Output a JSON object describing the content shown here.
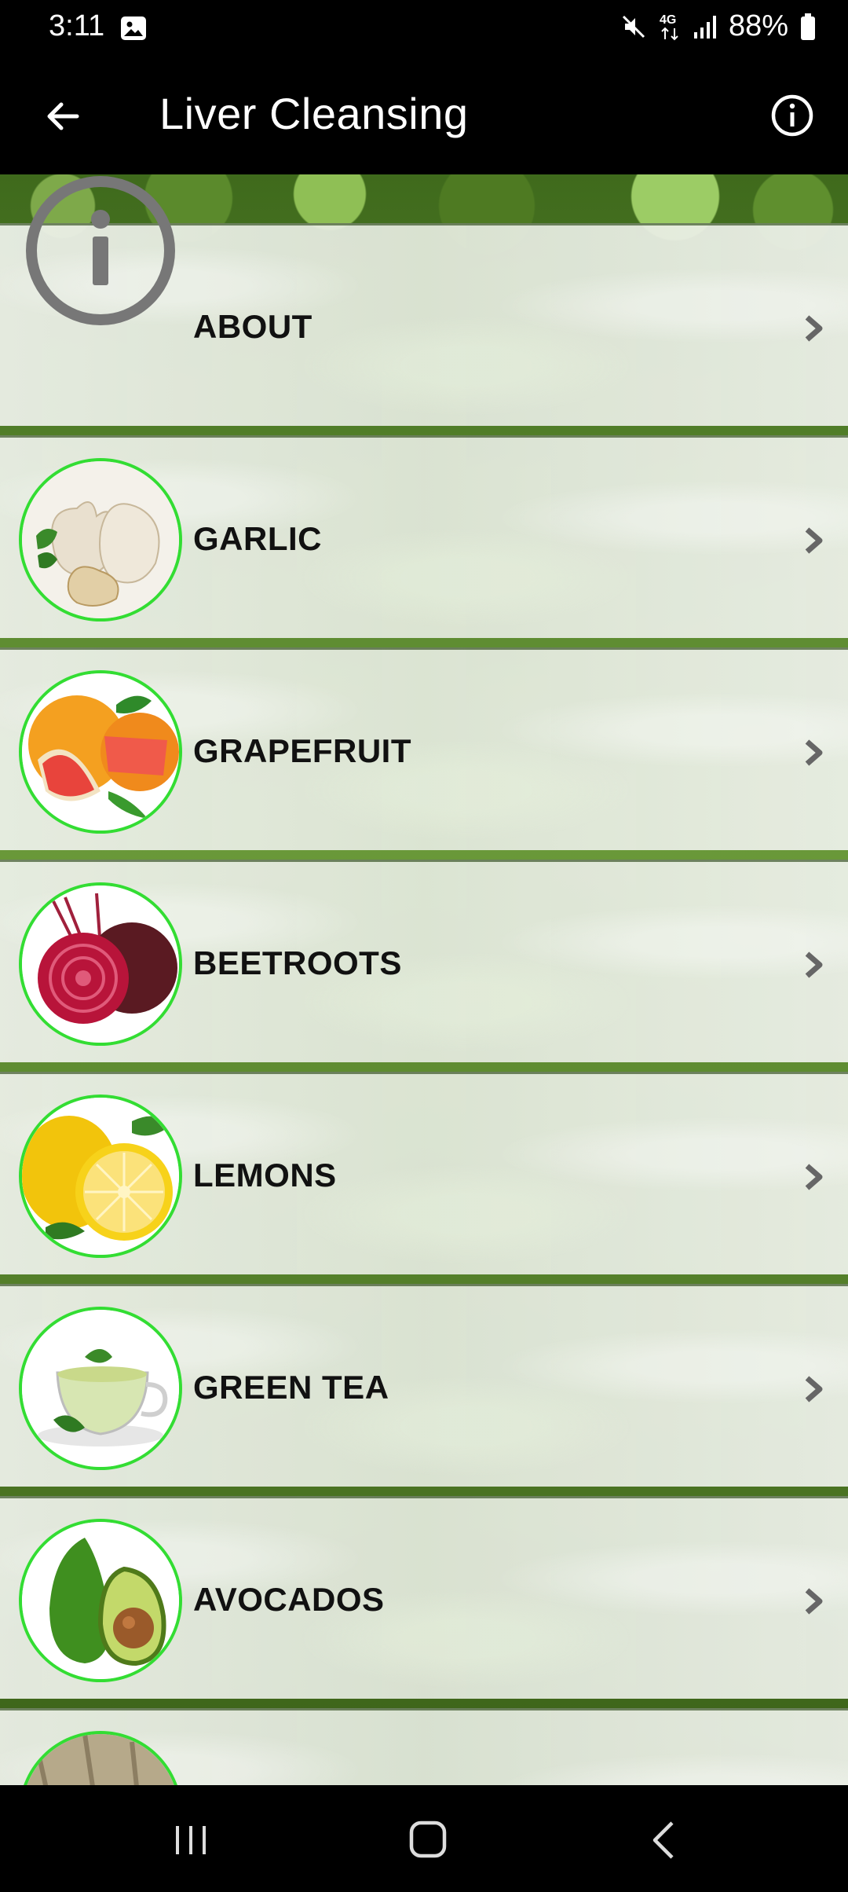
{
  "status_bar": {
    "time": "3:11",
    "battery": "88%",
    "icons": [
      "gallery-icon",
      "mute-icon",
      "4g-icon",
      "signal-icon",
      "battery-icon"
    ]
  },
  "app_bar": {
    "title": "Liver Cleansing",
    "back_icon": "back-arrow-icon",
    "info_icon": "info-icon"
  },
  "list": {
    "items": [
      {
        "label": "ABOUT",
        "icon": "info-circle-icon"
      },
      {
        "label": "GARLIC",
        "icon": "garlic-image"
      },
      {
        "label": "GRAPEFRUIT",
        "icon": "grapefruit-image"
      },
      {
        "label": "BEETROOTS",
        "icon": "beetroot-image"
      },
      {
        "label": "LEMONS",
        "icon": "lemon-image"
      },
      {
        "label": "GREEN TEA",
        "icon": "green-tea-image"
      },
      {
        "label": "AVOCADOS",
        "icon": "avocado-image"
      },
      {
        "label": "",
        "icon": "partial-item-image"
      }
    ]
  },
  "nav_bar": {
    "buttons": [
      "recents-icon",
      "home-icon",
      "back-icon"
    ]
  },
  "colors": {
    "accent_ring": "#33dd33",
    "bar_background": "#000000",
    "label_text": "#111111"
  }
}
